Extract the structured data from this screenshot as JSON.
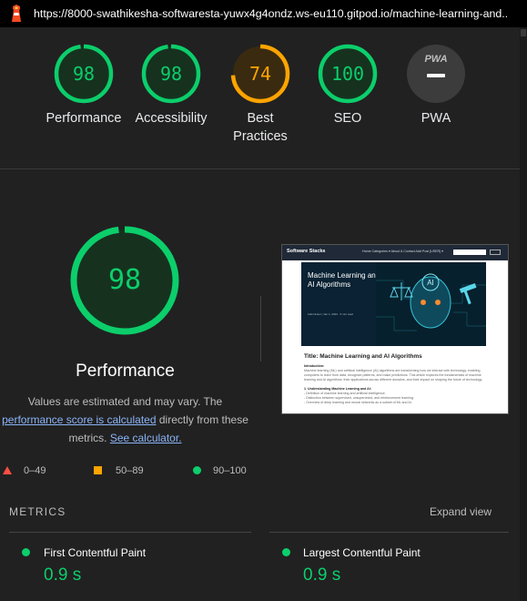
{
  "browser": {
    "url": "https://8000-swathikesha-softwaresta-yuwx4g4ondz.ws-eu110.gitpod.io/machine-learning-and..."
  },
  "colors": {
    "pass": "#0cce6b",
    "average": "#ffa400",
    "fail": "#ff4e42",
    "pwa_gray": "#9e9e9e"
  },
  "categories": [
    {
      "label": "Performance",
      "score": "98"
    },
    {
      "label": "Accessibility",
      "score": "98"
    },
    {
      "label": "Best Practices",
      "score": "74"
    },
    {
      "label": "SEO",
      "score": "100"
    },
    {
      "label": "PWA",
      "badge": "PWA"
    }
  ],
  "performance": {
    "score": "98",
    "title": "Performance",
    "desc_prefix": "Values are estimated and may vary. The",
    "desc_link": "performance score is calculated",
    "desc_mid": "directly from these metrics.",
    "desc_link2": "See calculator."
  },
  "preview": {
    "brand": "Software Stacks",
    "nav_links": "Home    Categories ▾    About & Contact    Add Post    [USER] ▾",
    "hero_title": "Machine Learning and AI Algorithms",
    "hero_meta": "AdminUser | Jan 1, 2024 · 5 min read",
    "hero_art_label": "AI",
    "post_title": "Title: Machine Learning and AI Algorithms",
    "intro_heading": "Introduction:",
    "intro_text": "Machine learning (ML) and artificial intelligence (AI) algorithms are transforming how we interact with technology, enabling computers to learn from data, recognize patterns, and make predictions. This article explores the fundamentals of machine learning and AI algorithms, their applications across different domains, and their impact on shaping the future of technology.",
    "section_heading": "1. Understanding Machine Learning and AI:",
    "section_items": [
      "- Definition of machine learning and artificial intelligence.",
      "- Distinction between supervised, unsupervised, and reinforcement learning.",
      "- Overview of deep learning and neural networks as a subset of ML and AI."
    ]
  },
  "legend": [
    {
      "range": "0–49",
      "shape": "triangle"
    },
    {
      "range": "50–89",
      "shape": "square"
    },
    {
      "range": "90–100",
      "shape": "circle"
    }
  ],
  "metrics": {
    "heading": "METRICS",
    "expand_label": "Expand view",
    "items": [
      {
        "name": "First Contentful Paint",
        "value": "0.9 s",
        "level": 1
      },
      {
        "name": "Largest Contentful Paint",
        "value": "0.9 s",
        "level": 1
      }
    ]
  }
}
